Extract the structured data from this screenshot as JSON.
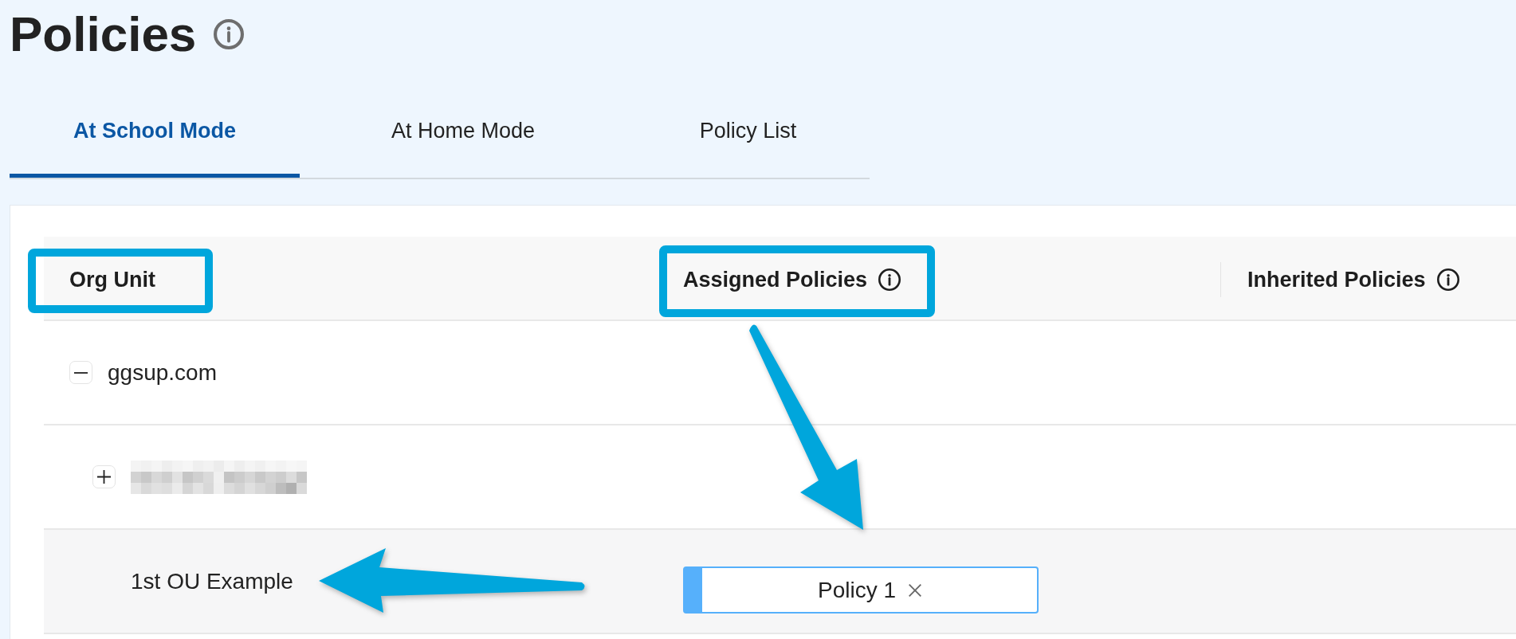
{
  "title": "Policies",
  "tabs": [
    {
      "label": "At School Mode",
      "selected": true
    },
    {
      "label": "At Home Mode",
      "selected": false
    },
    {
      "label": "Policy List",
      "selected": false
    }
  ],
  "table": {
    "columns": [
      {
        "label": "Org Unit",
        "info": false
      },
      {
        "label": "Assigned Policies",
        "info": true
      },
      {
        "label": "Inherited Policies",
        "info": true
      }
    ],
    "tree": [
      {
        "kind": "label",
        "label": "ggsup.com",
        "expanded": true,
        "children": [
          {
            "kind": "redacted",
            "expanded": false
          },
          {
            "kind": "label",
            "label": "1st OU Example",
            "highlighted": true,
            "assigned_policies": [
              "Policy 1"
            ]
          }
        ]
      }
    ]
  }
}
